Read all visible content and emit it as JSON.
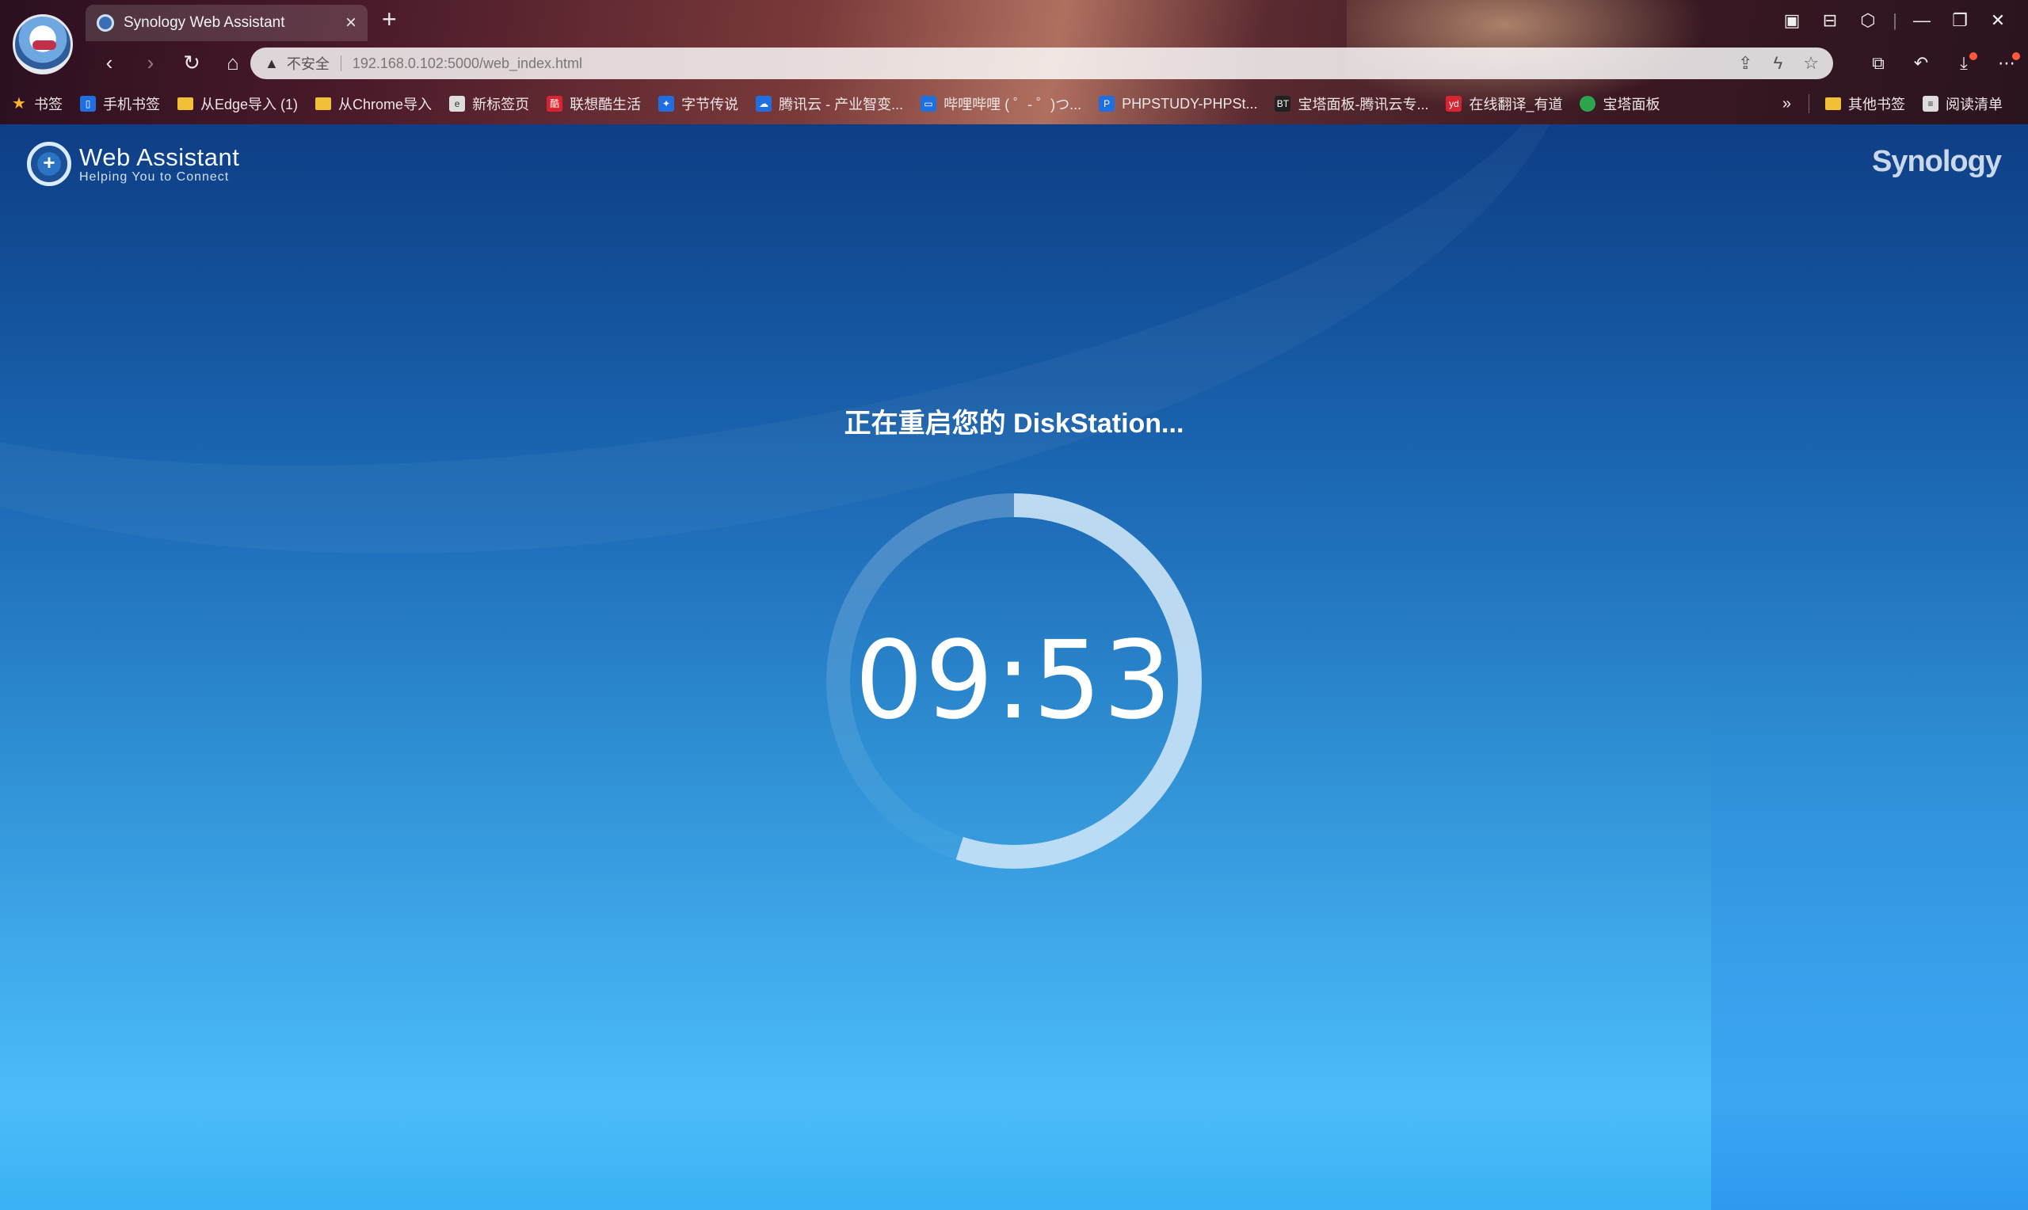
{
  "browser": {
    "tab": {
      "title": "Synology Web Assistant",
      "close_glyph": "×"
    },
    "new_tab_glyph": "+",
    "window_controls": {
      "minimize": "—",
      "restore": "❐",
      "close": "✕"
    },
    "nav": {
      "back": "‹",
      "forward": "›",
      "reload": "↻",
      "home": "⌂"
    },
    "address": {
      "security_label": "不安全",
      "url": "192.168.0.102:5000/web_index.html"
    },
    "bookmarks": [
      {
        "label": "书签",
        "icon": "star-icon"
      },
      {
        "label": "手机书签",
        "icon": "phone-icon"
      },
      {
        "label": "从Edge导入 (1)",
        "icon": "folder-icon"
      },
      {
        "label": "从Chrome导入",
        "icon": "folder-icon"
      },
      {
        "label": "新标签页",
        "icon": "edge-icon"
      },
      {
        "label": "联想酷生活",
        "icon": "lenovo-icon"
      },
      {
        "label": "字节传说",
        "icon": "bytes-icon"
      },
      {
        "label": "腾讯云 - 产业智变...",
        "icon": "tencent-cloud-icon"
      },
      {
        "label": "哔哩哔哩 ( ゜- ゜)つ...",
        "icon": "bilibili-icon"
      },
      {
        "label": "PHPSTUDY-PHPSt...",
        "icon": "phpstudy-icon"
      },
      {
        "label": "宝塔面板-腾讯云专...",
        "icon": "bt-icon"
      },
      {
        "label": "在线翻译_有道",
        "icon": "youdao-icon"
      },
      {
        "label": "宝塔面板",
        "icon": "bt-green-icon"
      }
    ],
    "bookmarks_more": "»",
    "other_bookmarks": "其他书签",
    "reading_list": "阅读清单"
  },
  "page": {
    "brand": {
      "title": "Web Assistant",
      "subtitle": "Helping You to Connect"
    },
    "vendor_logo": "Synology",
    "status_text": "正在重启您的 DiskStation...",
    "countdown": "09:53",
    "progress_fraction": 0.55,
    "colors": {
      "ring_track": "rgba(255,255,255,0.18)",
      "ring_fill": "#c8e2f6"
    }
  }
}
